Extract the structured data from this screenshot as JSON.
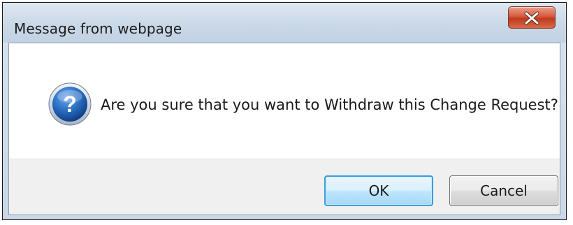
{
  "dialog": {
    "title": "Message from webpage",
    "message": "Are you sure that you want to Withdraw this Change Request?",
    "icon": "question-icon",
    "close_icon": "close-icon"
  },
  "buttons": {
    "ok_label": "OK",
    "cancel_label": "Cancel"
  },
  "colors": {
    "close_button": "#c8472a",
    "ok_border": "#3c9ed8",
    "question_icon": "#1d5fae"
  }
}
